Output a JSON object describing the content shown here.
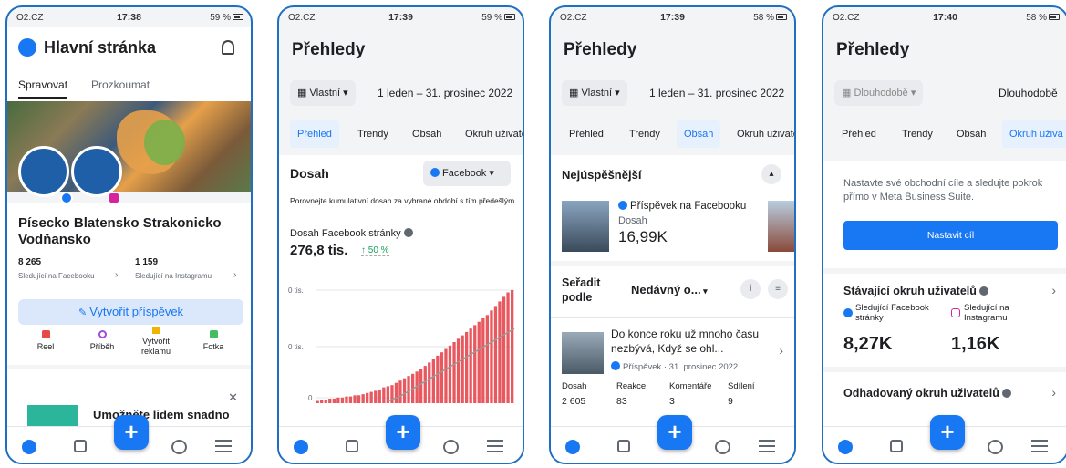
{
  "colors": {
    "accent": "#1877f2",
    "frame": "#1f6fc2",
    "chart_bar": "#e8585f",
    "chart_line": "#999999",
    "positive": "#1a9e5a"
  },
  "status": [
    {
      "carrier": "O2.CZ",
      "time": "17:38",
      "battery": "59 %"
    },
    {
      "carrier": "O2.CZ",
      "time": "17:39",
      "battery": "59 %"
    },
    {
      "carrier": "O2.CZ",
      "time": "17:39",
      "battery": "58 %"
    },
    {
      "carrier": "O2.CZ",
      "time": "17:40",
      "battery": "58 %"
    }
  ],
  "screen1": {
    "title": "Hlavní stránka",
    "tabs": [
      "Spravovat",
      "Prozkoumat"
    ],
    "page_name": "Písecko Blatensko Strakonicko Vodňansko",
    "fb_followers": "8 265",
    "fb_followers_label": "Sledující na Facebooku",
    "ig_followers": "1 159",
    "ig_followers_label": "Sledující na Instagramu",
    "create_post": "Vytvořit příspěvek",
    "actions": [
      "Reel",
      "Příběh",
      "Vytvořit reklamu",
      "Fotka"
    ],
    "promo_text": "Umožněte lidem snadno se o Písecko"
  },
  "screen2": {
    "title": "Přehledy",
    "range_selector": "Vlastní",
    "date_range": "1 leden – 31. prosinec 2022",
    "tabs": [
      "Přehled",
      "Trendy",
      "Obsah",
      "Okruh uživate"
    ],
    "section": "Dosah",
    "platform": "Facebook",
    "description": "Porovnejte kumulativní dosah za vybrané období s tím předešlým.",
    "metric_label": "Dosah Facebook stránky",
    "metric_value": "276,8 tis.",
    "metric_change": "↑ 50 %"
  },
  "chart_data": {
    "type": "bar",
    "title": "Dosah Facebook stránky",
    "y_tick_labels": [
      "0 tis.",
      "0 tis.",
      "0"
    ],
    "series": [
      {
        "values": [
          2,
          3,
          3,
          4,
          4,
          5,
          5,
          6,
          6,
          7,
          7,
          8,
          9,
          10,
          11,
          12,
          14,
          15,
          16,
          18,
          20,
          22,
          24,
          26,
          28,
          30,
          33,
          36,
          39,
          42,
          45,
          48,
          51,
          54,
          57,
          60,
          63,
          66,
          69,
          72,
          75,
          78,
          82,
          86,
          90,
          94,
          98,
          100
        ]
      },
      {
        "values": [
          2,
          4,
          6,
          9,
          12,
          15,
          18,
          21,
          24,
          27,
          30,
          33,
          36,
          39,
          42,
          45,
          48,
          51,
          54,
          57,
          60,
          63,
          66
        ]
      }
    ]
  },
  "screen3": {
    "title": "Přehledy",
    "range_selector": "Vlastní",
    "date_range": "1 leden – 31. prosinec 2022",
    "tabs": [
      "Přehled",
      "Trendy",
      "Obsah",
      "Okruh uživate"
    ],
    "top_section": "Nejúspěšnější",
    "top_post_type": "Příspěvek na Facebooku",
    "top_post_metric": "Dosah",
    "top_post_value": "16,99K",
    "sort_label": "Seřadit podle",
    "sort_value": "Nedávný o...",
    "post_text": "Do konce roku už mnoho času nezbývá, Když se ohl...",
    "post_meta": "Příspěvek · 31. prosinec 2022",
    "stat_labels": [
      "Dosah",
      "Reakce",
      "Komentáře",
      "Sdílení"
    ],
    "stat_values": [
      "2 605",
      "83",
      "3",
      "9"
    ]
  },
  "screen4": {
    "title": "Přehledy",
    "range_selector": "Dlouhodobě",
    "range_label": "Dlouhodobě",
    "tabs": [
      "Přehled",
      "Trendy",
      "Obsah",
      "Okruh uživa"
    ],
    "goal_text": "Nastavte své obchodní cíle a sledujte pokrok přímo v Meta Business Suite.",
    "goal_button": "Nastavit cíl",
    "audience_title": "Stávající okruh uživatelů",
    "fb_label": "Sledující Facebook stránky",
    "ig_label": "Sledující na Instagramu",
    "fb_value": "8,27K",
    "ig_value": "1,16K",
    "estimated_title": "Odhadovaný okruh uživatelů"
  },
  "icons": [
    "meta-logo-icon",
    "bell-icon",
    "calendar-icon",
    "chevron-down-icon",
    "facebook-icon",
    "instagram-icon",
    "info-icon",
    "chevron-right-icon",
    "filter-icon",
    "close-icon",
    "home-icon",
    "feed-icon",
    "plus-icon",
    "chat-icon",
    "menu-icon"
  ]
}
